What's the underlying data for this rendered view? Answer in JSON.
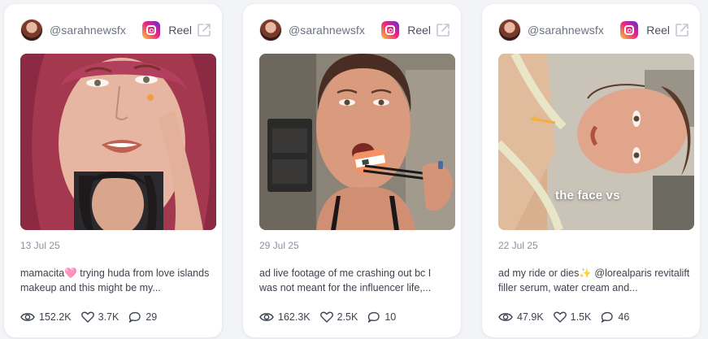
{
  "cards": [
    {
      "handle": "@sarahnewsfx",
      "platform_label": "Reel",
      "date": "13 Jul 25",
      "caption": "mamacita🩷 trying huda from love islands makeup and this might be my...",
      "views": "152.2K",
      "likes": "3.7K",
      "comments": "29"
    },
    {
      "handle": "@sarahnewsfx",
      "platform_label": "Reel",
      "date": "29 Jul 25",
      "caption": "ad live footage of me crashing out bc I was not meant for the influencer life,...",
      "views": "162.3K",
      "likes": "2.5K",
      "comments": "10"
    },
    {
      "handle": "@sarahnewsfx",
      "platform_label": "Reel",
      "date": "22 Jul 25",
      "caption": "ad my ride or dies✨ @lorealparis revitalift filler serum, water cream and...",
      "views": "47.9K",
      "likes": "1.5K",
      "comments": "46",
      "overlay_text": "the face vs"
    }
  ],
  "icons": {
    "platform": "instagram-icon",
    "open": "external-link-icon",
    "views": "eye-icon",
    "likes": "heart-icon",
    "comments": "comment-icon"
  },
  "colors": {
    "background": "#f3f4f7",
    "card": "#ffffff",
    "muted_text": "#8a90a0",
    "body_text": "#3d4250"
  }
}
